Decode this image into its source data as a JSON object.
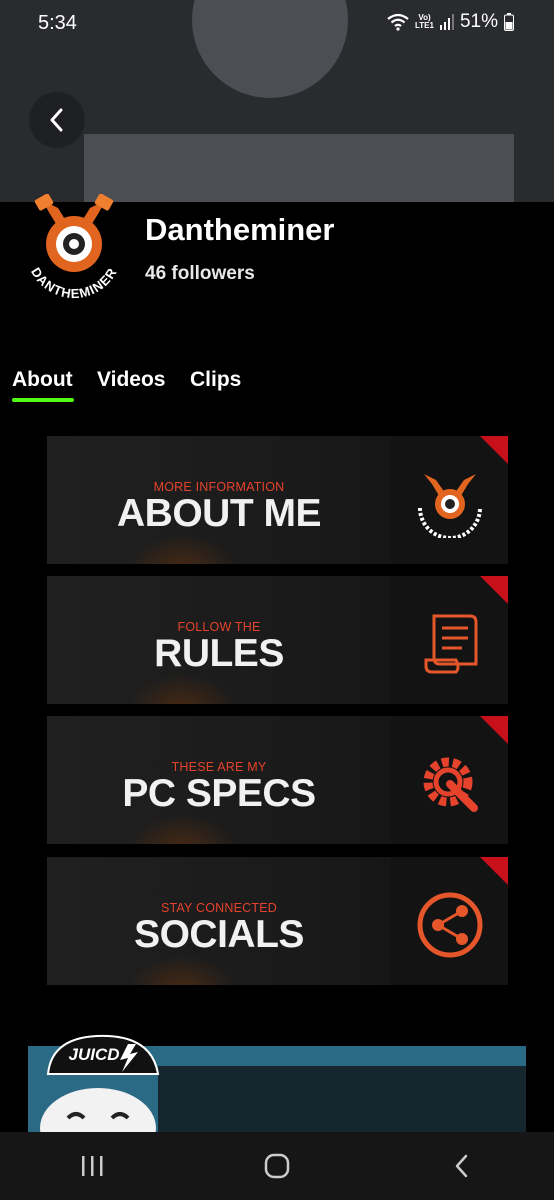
{
  "status": {
    "time": "5:34",
    "volte": "Vo)",
    "lte": "LTE1",
    "battery": "51%"
  },
  "channel": {
    "name": "Dantheminer",
    "followers": "46 followers",
    "logo_text": "DANTHEMINER"
  },
  "tabs": [
    {
      "label": "About",
      "active": true
    },
    {
      "label": "Videos",
      "active": false
    },
    {
      "label": "Clips",
      "active": false
    }
  ],
  "panels": [
    {
      "subtitle": "MORE INFORMATION",
      "title": "ABOUT ME",
      "icon": "logo-icon"
    },
    {
      "subtitle": "FOLLOW THE",
      "title": "RULES",
      "icon": "scroll-icon"
    },
    {
      "subtitle": "THESE ARE MY",
      "title": "PC SPECS",
      "icon": "gear-wrench-icon"
    },
    {
      "subtitle": "STAY CONNECTED",
      "title": "SOCIALS",
      "icon": "share-icon"
    }
  ],
  "promo": {
    "brand": "JUICD"
  },
  "colors": {
    "accent": "#53fc18",
    "panel_orange": "#e5432c",
    "panel_red": "#c8101b"
  }
}
